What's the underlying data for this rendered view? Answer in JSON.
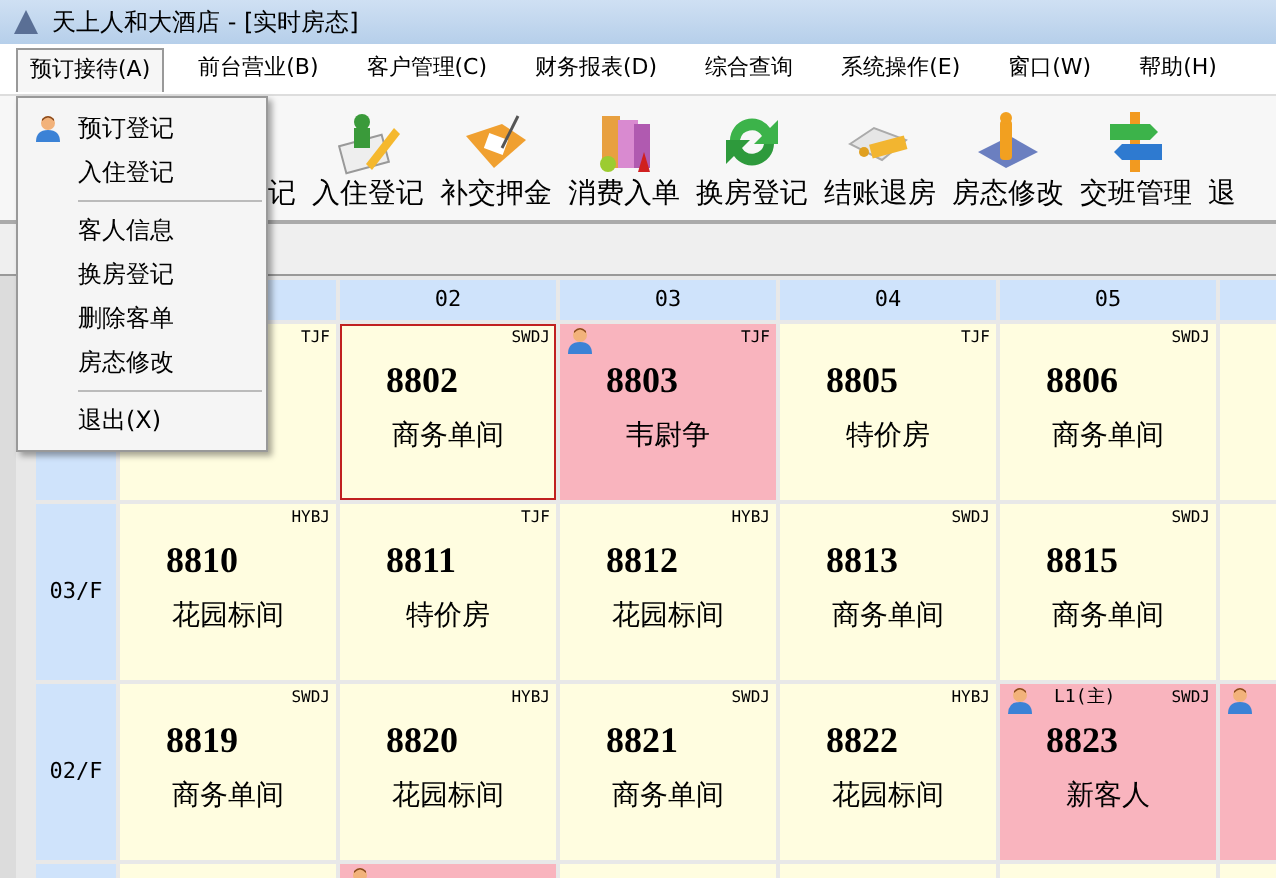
{
  "window": {
    "title": "天上人和大酒店 - [实时房态]"
  },
  "menu_bar": [
    {
      "label": "预订接待(A)",
      "selected": true
    },
    {
      "label": "前台营业(B)",
      "selected": false
    },
    {
      "label": "客户管理(C)",
      "selected": false
    },
    {
      "label": "财务报表(D)",
      "selected": false
    },
    {
      "label": "综合查询",
      "selected": false
    },
    {
      "label": "系统操作(E)",
      "selected": false
    },
    {
      "label": "窗口(W)",
      "selected": false
    },
    {
      "label": "帮助(H)",
      "selected": false
    }
  ],
  "dropdown": [
    {
      "kind": "item",
      "label": "预订登记",
      "has_icon": true
    },
    {
      "kind": "item",
      "label": "入住登记",
      "has_icon": false
    },
    {
      "kind": "separator"
    },
    {
      "kind": "item",
      "label": "客人信息",
      "has_icon": false
    },
    {
      "kind": "item",
      "label": "换房登记",
      "has_icon": false
    },
    {
      "kind": "item",
      "label": "删除客单",
      "has_icon": false
    },
    {
      "kind": "item",
      "label": "房态修改",
      "has_icon": false
    },
    {
      "kind": "separator"
    },
    {
      "kind": "item",
      "label": "退出(X)",
      "has_icon": false
    }
  ],
  "toolbar": [
    {
      "label": "记"
    },
    {
      "label": "入住登记"
    },
    {
      "label": "补交押金"
    },
    {
      "label": "消费入单"
    },
    {
      "label": "换房登记"
    },
    {
      "label": "结账退房"
    },
    {
      "label": "房态修改"
    },
    {
      "label": "交班管理"
    },
    {
      "label": "退"
    }
  ],
  "grid": {
    "columns": [
      {},
      {
        "label": "02"
      },
      {
        "label": "03"
      },
      {
        "label": "04"
      },
      {
        "label": "05"
      },
      {}
    ],
    "rows": [
      {
        "cells": [
          {
            "kind": "vacant",
            "code": "TJF"
          },
          {
            "kind": "vacant",
            "selected": true,
            "code": "SWDJ",
            "room": "8802",
            "name": "商务单间"
          },
          {
            "kind": "occupied",
            "guest": true,
            "code": "TJF",
            "room": "8803",
            "name": "韦尉争"
          },
          {
            "kind": "vacant",
            "code": "TJF",
            "room": "8805",
            "name": "特价房"
          },
          {
            "kind": "vacant",
            "code": "SWDJ",
            "room": "8806",
            "name": "商务单间"
          },
          {
            "kind": "vacant"
          }
        ]
      },
      {
        "floor": "03/F",
        "cells": [
          {
            "kind": "vacant",
            "code": "HYBJ",
            "room": "8810",
            "name": "花园标间"
          },
          {
            "kind": "vacant",
            "code": "TJF",
            "room": "8811",
            "name": "特价房"
          },
          {
            "kind": "vacant",
            "code": "HYBJ",
            "room": "8812",
            "name": "花园标间"
          },
          {
            "kind": "vacant",
            "code": "SWDJ",
            "room": "8813",
            "name": "商务单间"
          },
          {
            "kind": "vacant",
            "code": "SWDJ",
            "room": "8815",
            "name": "商务单间"
          },
          {
            "kind": "vacant"
          }
        ]
      },
      {
        "floor": "02/F",
        "cells": [
          {
            "kind": "vacant",
            "code": "SWDJ",
            "room": "8819",
            "name": "商务单间"
          },
          {
            "kind": "vacant",
            "code": "HYBJ",
            "room": "8820",
            "name": "花园标间"
          },
          {
            "kind": "vacant",
            "code": "SWDJ",
            "room": "8821",
            "name": "商务单间"
          },
          {
            "kind": "vacant",
            "code": "HYBJ",
            "room": "8822",
            "name": "花园标间"
          },
          {
            "kind": "occupied",
            "guest": true,
            "tag": "L1(主)",
            "code": "SWDJ",
            "room": "8823",
            "name": "新客人"
          },
          {
            "kind": "occupied",
            "guest": true
          }
        ]
      },
      {
        "cells": [
          {
            "kind": "vacant"
          },
          {
            "kind": "occupied",
            "guest": true
          },
          {
            "kind": "vacant"
          },
          {
            "kind": "vacant"
          },
          {
            "kind": "vacant"
          },
          {
            "kind": "vacant"
          }
        ]
      }
    ]
  }
}
